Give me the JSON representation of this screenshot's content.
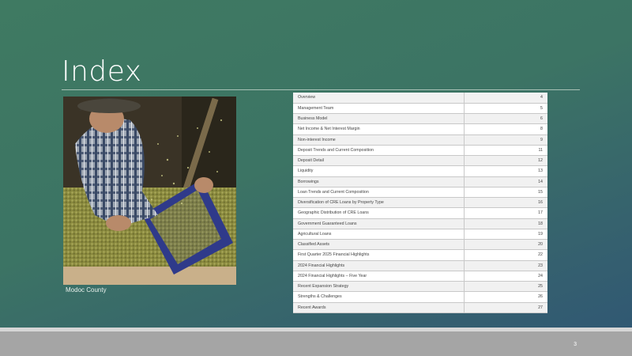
{
  "slide": {
    "title": "Index",
    "caption": "Modoc County",
    "page_number": "3"
  },
  "photo": {
    "icon": "farmer-sorting-grain-photo"
  },
  "index": [
    {
      "topic": "Overview",
      "page": "4"
    },
    {
      "topic": "Management Team",
      "page": "5"
    },
    {
      "topic": "Business Model",
      "page": "6"
    },
    {
      "topic": "Net Income & Net Interest Margin",
      "page": "8"
    },
    {
      "topic": "Non-interest Income",
      "page": "9"
    },
    {
      "topic": "Deposit Trends and Current Composition",
      "page": "11"
    },
    {
      "topic": "Deposit Detail",
      "page": "12"
    },
    {
      "topic": "Liquidity",
      "page": "13"
    },
    {
      "topic": "Borrowings",
      "page": "14"
    },
    {
      "topic": "Loan Trends and Current Composition",
      "page": "15"
    },
    {
      "topic": "Diversification of CRE Loans by Property Type",
      "page": "16"
    },
    {
      "topic": "Geographic Distribution of CRE Loans",
      "page": "17"
    },
    {
      "topic": "Government Guaranteed Loans",
      "page": "18"
    },
    {
      "topic": "Agricultural Loans",
      "page": "19"
    },
    {
      "topic": "Classified Assets",
      "page": "20"
    },
    {
      "topic": "First Quarter 2025 Financial Highlights",
      "page": "22"
    },
    {
      "topic": "2024 Financial Highlights",
      "page": "23"
    },
    {
      "topic": "2024 Financial Highlights – Five Year",
      "page": "24"
    },
    {
      "topic": "Recent Expansion Strategy",
      "page": "25"
    },
    {
      "topic": "Strengths & Challenges",
      "page": "26"
    },
    {
      "topic": "Recent Awards",
      "page": "27"
    }
  ]
}
